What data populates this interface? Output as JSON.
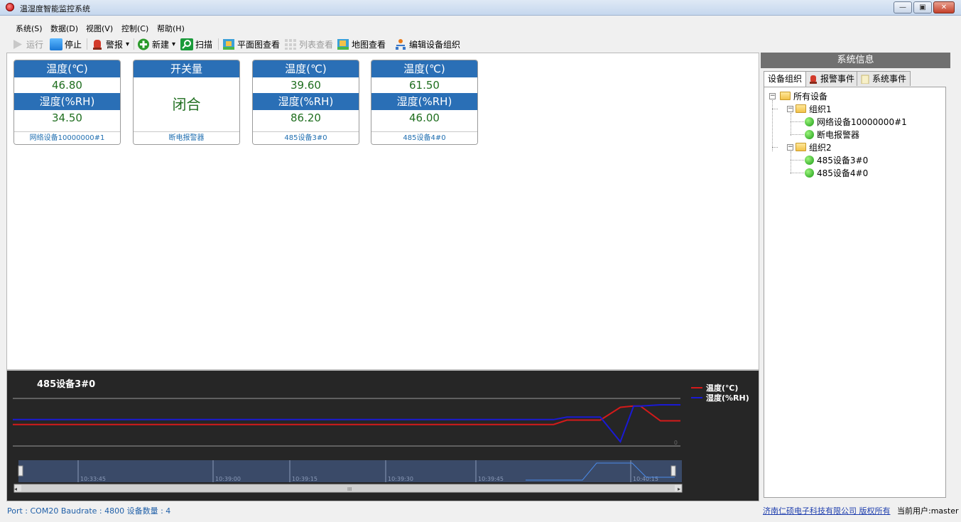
{
  "window": {
    "title": "温湿度智能监控系统",
    "min_glyph": "—",
    "max_glyph": "▣",
    "close_glyph": "✕"
  },
  "menu": [
    {
      "label": "系统(S)"
    },
    {
      "label": "数据(D)"
    },
    {
      "label": "视图(V)"
    },
    {
      "label": "控制(C)"
    },
    {
      "label": "帮助(H)"
    }
  ],
  "toolbar": {
    "run": "运行",
    "stop": "停止",
    "alarm": "警报",
    "new": "新建",
    "scan": "扫描",
    "plan_view": "平面图查看",
    "list_view": "列表查看",
    "map_view": "地图查看",
    "edit_org": "编辑设备组织",
    "dropdown_glyph": "▾"
  },
  "cards": [
    {
      "head1": "温度(℃)",
      "val1": "46.80",
      "head2": "湿度(%RH)",
      "val2": "34.50",
      "footer": "网络设备10000000#1"
    },
    {
      "head1": "开关量",
      "switch_value": "闭合",
      "footer": "断电报警器"
    },
    {
      "head1": "温度(℃)",
      "val1": "39.60",
      "head2": "湿度(%RH)",
      "val2": "86.20",
      "footer": "485设备3#0"
    },
    {
      "head1": "温度(℃)",
      "val1": "61.50",
      "head2": "湿度(%RH)",
      "val2": "46.00",
      "footer": "485设备4#0"
    }
  ],
  "chart": {
    "title": "485设备3#0",
    "zero_label": "0",
    "scroll_label": "III",
    "legend": {
      "temp": "温度(℃)",
      "humidity": "湿度(%RH)"
    },
    "colors": {
      "temp": "#d41a1a",
      "humidity": "#1a1ad4"
    }
  },
  "chart_data": {
    "type": "line",
    "title": "485设备3#0",
    "x": [
      0,
      0.81,
      0.83,
      0.88,
      0.91,
      0.93,
      0.94,
      0.97,
      1.0
    ],
    "series": [
      {
        "name": "温度(℃)",
        "values": [
          0.2,
          0.2,
          0.38,
          0.38,
          0.9,
          0.95,
          0.95,
          0.35,
          0.35
        ]
      },
      {
        "name": "湿度(%RH)",
        "values": [
          0.4,
          0.4,
          0.5,
          0.5,
          -0.5,
          0.95,
          0.95,
          1.0,
          1.0
        ]
      }
    ],
    "navigator_ticks": [
      "10:33:45",
      "10:39:00",
      "10:39:15",
      "10:39:30",
      "10:39:45",
      "10:40:15"
    ],
    "legend_position": "top-right"
  },
  "right_panel": {
    "header": "系统信息",
    "tabs": [
      {
        "label": "设备组织"
      },
      {
        "label": "报警事件"
      },
      {
        "label": "系统事件"
      }
    ],
    "tree": {
      "root": "所有设备",
      "group1": "组织1",
      "g1_dev1": "网络设备10000000#1",
      "g1_dev2": "断电报警器",
      "group2": "组织2",
      "g2_dev1": "485设备3#0",
      "g2_dev2": "485设备4#0"
    }
  },
  "status": {
    "left": "Port : COM20    Baudrate : 4800    设备数量 : 4",
    "company": "济南仁硕电子科技有限公司 版权所有",
    "user": "当前用户:master"
  }
}
